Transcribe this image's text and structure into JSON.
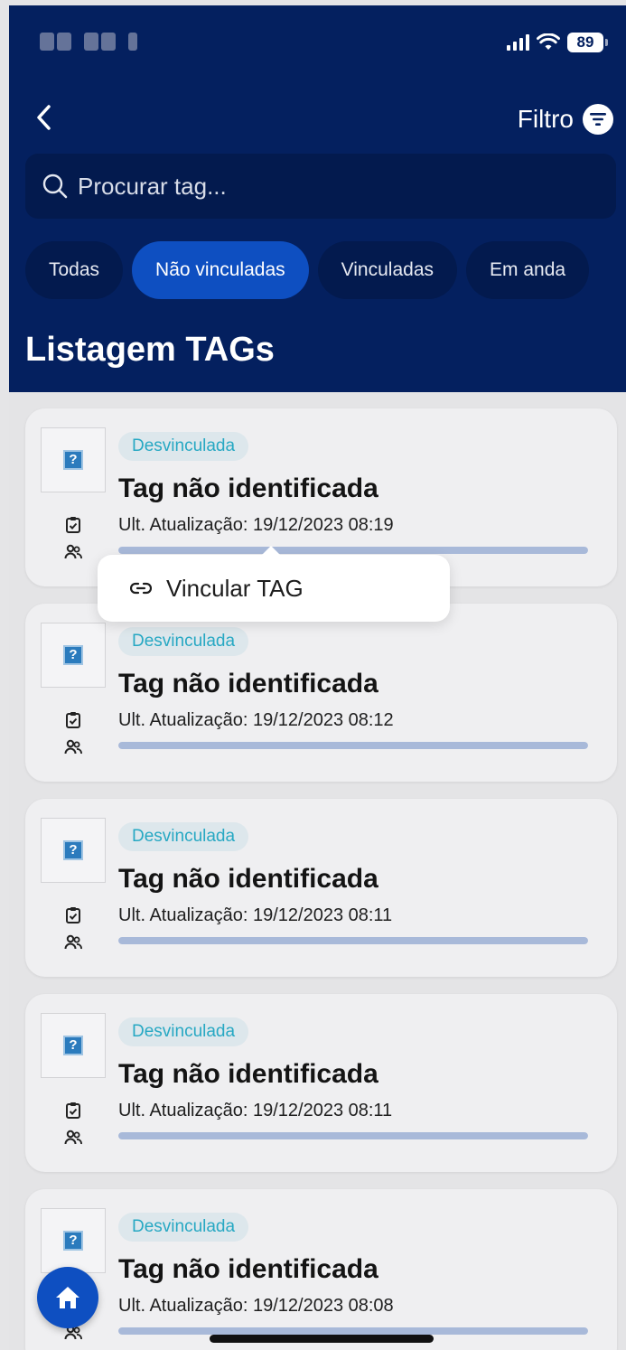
{
  "status_bar": {
    "battery": "89"
  },
  "header": {
    "back_icon": "chevron-left-icon",
    "filter_label": "Filtro",
    "filter_icon": "filter-icon"
  },
  "search": {
    "placeholder": "Procurar tag...",
    "icon": "search-icon"
  },
  "tabs": [
    {
      "label": "Todas",
      "active": false
    },
    {
      "label": "Não vinculadas",
      "active": true
    },
    {
      "label": "Vinculadas",
      "active": false
    },
    {
      "label": "Em anda",
      "active": false
    }
  ],
  "page_title": "Listagem TAGs",
  "cards": [
    {
      "status": "Desvinculada",
      "title": "Tag não identificada",
      "updated": "Ult. Atualização: 19/12/2023 08:19",
      "progress": 1.0
    },
    {
      "status": "Desvinculada",
      "title": "Tag não identificada",
      "updated": "Ult. Atualização: 19/12/2023 08:12",
      "progress": 1.0
    },
    {
      "status": "Desvinculada",
      "title": "Tag não identificada",
      "updated": "Ult. Atualização: 19/12/2023 08:11",
      "progress": 1.0
    },
    {
      "status": "Desvinculada",
      "title": "Tag não identificada",
      "updated": "Ult. Atualização: 19/12/2023 08:11",
      "progress": 1.0
    },
    {
      "status": "Desvinculada",
      "title": "Tag não identificada",
      "updated": "Ult. Atualização: 19/12/2023 08:08",
      "progress": 1.0
    }
  ],
  "popover": {
    "label": "Vincular TAG",
    "icon": "link-icon"
  },
  "colors": {
    "header_bg": "#04205f",
    "accent": "#0e4fc1",
    "badge_text": "#27a8c3",
    "progress": "#a8b9d9"
  }
}
